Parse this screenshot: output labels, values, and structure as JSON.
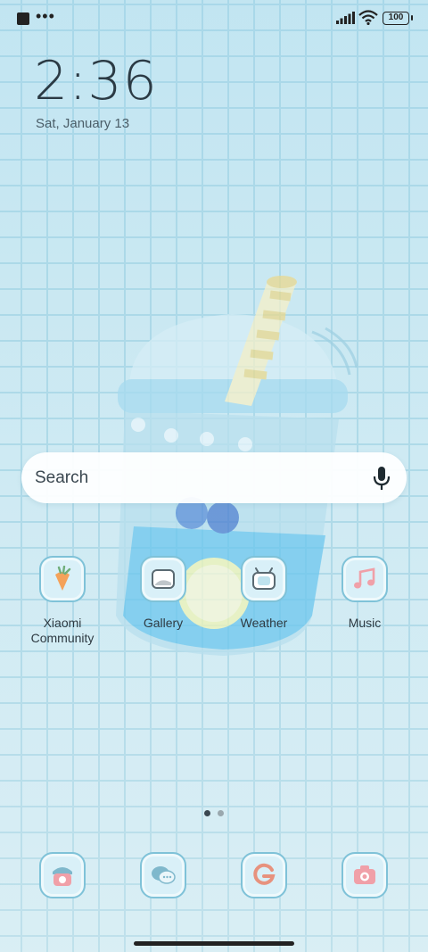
{
  "status_bar": {
    "left_indicator": "more-notifications-icon",
    "dots": "•••",
    "battery": "100"
  },
  "clock": {
    "time": "2:36",
    "date": "Sat, January 13"
  },
  "search": {
    "placeholder": "Search",
    "icon": "mic-icon"
  },
  "apps": [
    {
      "label": "Xiaomi\nCommunity",
      "icon": "carrot-icon"
    },
    {
      "label": "Gallery",
      "icon": "gallery-icon"
    },
    {
      "label": "Weather",
      "icon": "weather-tv-icon"
    },
    {
      "label": "Music",
      "icon": "music-note-icon"
    }
  ],
  "dock": [
    {
      "icon": "phone-icon"
    },
    {
      "icon": "messages-icon"
    },
    {
      "icon": "google-icon"
    },
    {
      "icon": "camera-icon"
    }
  ],
  "pages": {
    "count": 2,
    "current": 1
  },
  "colors": {
    "accent": "#7fc2d8",
    "icon_fill": "#d9f0f8",
    "pink": "#f0a0a8",
    "orange": "#f4a25a"
  }
}
